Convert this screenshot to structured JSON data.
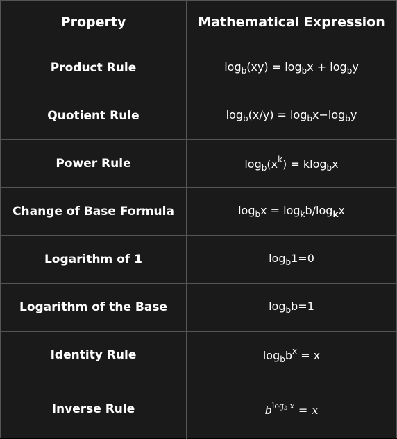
{
  "header": {
    "col1": "Property",
    "col2": "Mathematical Expression"
  },
  "rows": [
    {
      "property": "Product Rule",
      "expr": {
        "a": "log",
        "b": "b",
        "c": "(xy) = log",
        "d": "b",
        "e": "x + log",
        "f": "b",
        "g": "y"
      }
    },
    {
      "property": "Quotient Rule",
      "expr": {
        "a": "log",
        "b": "b",
        "c": "(x/y) = log",
        "d": "b",
        "e": "x−log",
        "f": "b",
        "g": "y"
      }
    },
    {
      "property": "Power Rule",
      "expr": {
        "a": "log",
        "b": "b",
        "c": "(x",
        "k": "k",
        "d": ") = klog",
        "e": "b",
        "f": "x"
      }
    },
    {
      "property": "Change of Base Formula",
      "expr": {
        "a": "log",
        "b": "b",
        "c": "x = log",
        "d": "k",
        "e": "b/log",
        "f": "k",
        "g": "x"
      }
    },
    {
      "property": "Logarithm of 1",
      "expr": {
        "a": "log",
        "b": "b",
        "c": "1=0"
      }
    },
    {
      "property": "Logarithm of the Base",
      "expr": {
        "a": "log",
        "b": "b",
        "c": "b=1"
      }
    },
    {
      "property": "Identity Rule",
      "expr": {
        "a": "log",
        "b": "b",
        "c": "b",
        "x": "x",
        "d": " = x"
      }
    },
    {
      "property": "Inverse Rule",
      "expr": {
        "base": "b",
        "log": "log",
        "sub": "b",
        "var": " x",
        "eq": "=",
        "rhs": "x"
      }
    }
  ]
}
